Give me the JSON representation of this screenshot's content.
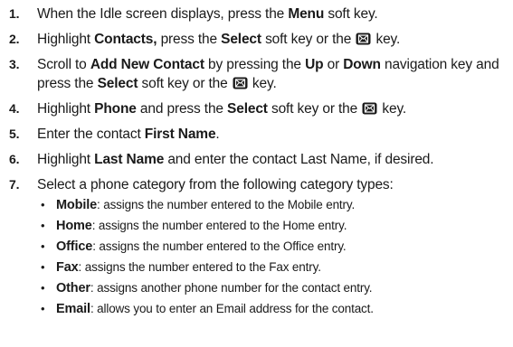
{
  "steps": [
    {
      "num": "1.",
      "parts": [
        {
          "t": "When the Idle screen displays, press the "
        },
        {
          "t": "Menu",
          "b": true
        },
        {
          "t": " soft key."
        }
      ]
    },
    {
      "num": "2.",
      "parts": [
        {
          "t": "Highlight "
        },
        {
          "t": "Contacts,",
          "b": true
        },
        {
          "t": " press the "
        },
        {
          "t": "Select",
          "b": true
        },
        {
          "t": " soft key or the "
        },
        {
          "icon": "ok-key-icon"
        },
        {
          "t": " key."
        }
      ]
    },
    {
      "num": "3.",
      "parts": [
        {
          "t": "Scroll to "
        },
        {
          "t": "Add New Contact",
          "b": true
        },
        {
          "t": " by pressing the "
        },
        {
          "t": "Up",
          "b": true
        },
        {
          "t": " or "
        },
        {
          "t": "Down",
          "b": true
        },
        {
          "t": " navigation key and press the "
        },
        {
          "t": "Select",
          "b": true
        },
        {
          "t": " soft key or the "
        },
        {
          "icon": "ok-key-icon"
        },
        {
          "t": " key."
        }
      ]
    },
    {
      "num": "4.",
      "parts": [
        {
          "t": "Highlight "
        },
        {
          "t": "Phone",
          "b": true
        },
        {
          "t": " and press the "
        },
        {
          "t": "Select",
          "b": true
        },
        {
          "t": " soft key or the "
        },
        {
          "icon": "ok-key-icon"
        },
        {
          "t": " key."
        }
      ]
    },
    {
      "num": "5.",
      "parts": [
        {
          "t": "Enter the contact "
        },
        {
          "t": "First Name",
          "b": true
        },
        {
          "t": "."
        }
      ]
    },
    {
      "num": "6.",
      "parts": [
        {
          "t": "Highlight "
        },
        {
          "t": "Last Name",
          "b": true
        },
        {
          "t": " and enter the contact Last Name, if desired."
        }
      ]
    },
    {
      "num": "7.",
      "parts": [
        {
          "t": "Select a phone category from the following category types:"
        }
      ],
      "subitems": [
        {
          "term": "Mobile",
          "desc": ": assigns the number entered to the Mobile entry."
        },
        {
          "term": "Home",
          "desc": ": assigns the number entered to the Home entry."
        },
        {
          "term": "Office",
          "desc": ": assigns the number entered to the Office entry."
        },
        {
          "term": "Fax",
          "desc": ": assigns the number entered to the Fax entry."
        },
        {
          "term": "Other",
          "desc": ": assigns another phone number for the contact entry."
        },
        {
          "term": "Email",
          "desc": ": allows you to enter an Email address for the contact."
        }
      ]
    }
  ],
  "bullet_glyph": "•"
}
